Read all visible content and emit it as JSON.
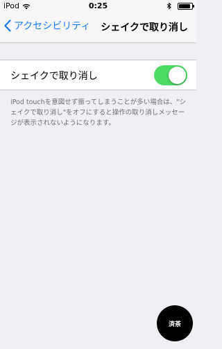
{
  "status_bar": {
    "carrier": "iPod",
    "time": "0:25",
    "battery_level": 0.9
  },
  "navbar": {
    "back_label": "アクセシビリティ",
    "title": "シェイクで取り消し"
  },
  "setting": {
    "label": "シェイクで取り消し",
    "enabled": true,
    "on_color": "#4cd964"
  },
  "footnote": "iPod touchを意図せず振ってしまうことが多い場合は、\"シェイクで取り消し\"をオフにすると操作の取り消しメッセージが表示されないようになります。",
  "watermark": "済茶"
}
